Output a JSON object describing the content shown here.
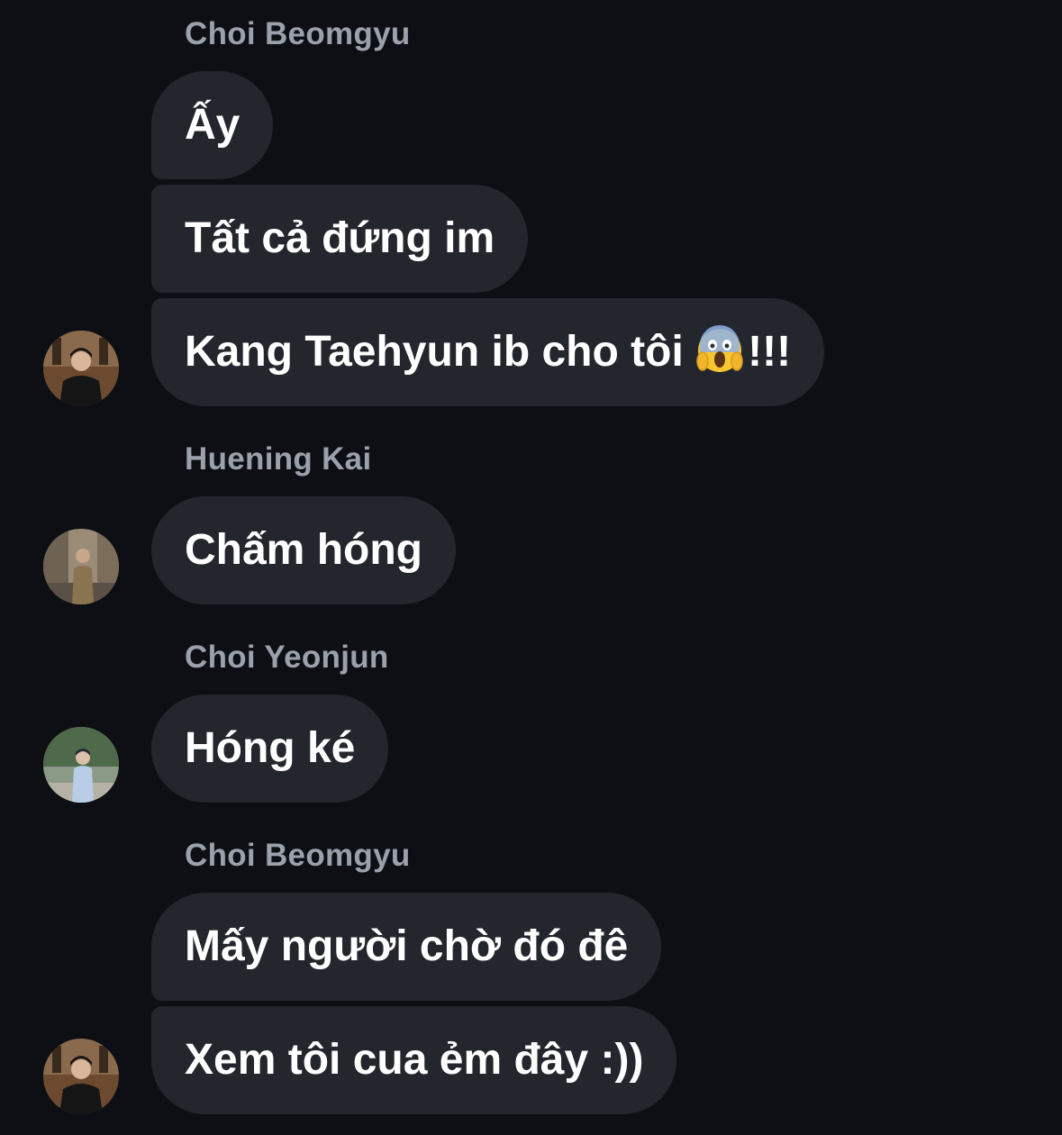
{
  "groups": [
    {
      "sender": "Choi Beomgyu",
      "messages": [
        "Ấy",
        "Tất cả đứng im"
      ],
      "last_message_before_emoji": "Kang Taehyun ib cho tôi ",
      "last_message_after_emoji": "!!!",
      "emoji_icon": "face-screaming-in-fear-icon"
    },
    {
      "sender": "Huening Kai",
      "messages": [
        "Chấm hóng"
      ]
    },
    {
      "sender": "Choi Yeonjun",
      "messages": [
        "Hóng ké"
      ]
    },
    {
      "sender": "Choi Beomgyu",
      "messages": [
        "Mấy người chờ đó đê",
        "Xem tôi cua ẻm đây :))"
      ]
    }
  ],
  "theme": {
    "background": "#0d0f14",
    "bubble": "#23262c",
    "sender_name": "#9aa1ac",
    "message_text": "#ffffff"
  }
}
